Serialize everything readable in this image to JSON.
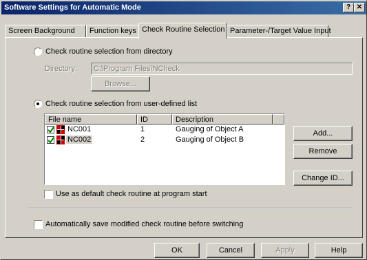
{
  "window": {
    "title": "Software Settings for Automatic Mode",
    "help_glyph": "?",
    "close_glyph": "✕"
  },
  "tabs": [
    {
      "label": "Screen Background"
    },
    {
      "label": "Function keys"
    },
    {
      "label": "Check Routine Selection"
    },
    {
      "label": "Parameter-/Target Value Input"
    }
  ],
  "directory_option": {
    "label": "Check routine selection from directory",
    "selected": false,
    "directory_label": "Directory:",
    "directory_value": "C:\\Program Files\\NCheck",
    "browse_label": "Browse..."
  },
  "list_option": {
    "label": "Check routine selection from user-defined list",
    "selected": true
  },
  "routine_list": {
    "columns": [
      "File name",
      "ID",
      "Description"
    ],
    "rows": [
      {
        "name": "NC001",
        "id": "1",
        "description": "Gauging of Object A",
        "checked": true,
        "selected": false
      },
      {
        "name": "NC002",
        "id": "2",
        "description": "Gauging of Object  B",
        "checked": true,
        "selected": true
      }
    ]
  },
  "side_buttons": {
    "add": "Add...",
    "remove": "Remove",
    "change_id": "Change ID..."
  },
  "default_checkbox": {
    "label": "Use as default check routine at program start",
    "checked": false
  },
  "autosave_checkbox": {
    "label": "Automatically save modified check routine before switching",
    "checked": false
  },
  "footer": {
    "ok": "OK",
    "cancel": "Cancel",
    "apply": "Apply",
    "help": "Help"
  },
  "colors": {
    "title_start": "#0a246a",
    "title_end": "#3a6ea5",
    "face": "#d4d0c8",
    "check_green": "#008000",
    "icon_red": "#cc0000"
  }
}
